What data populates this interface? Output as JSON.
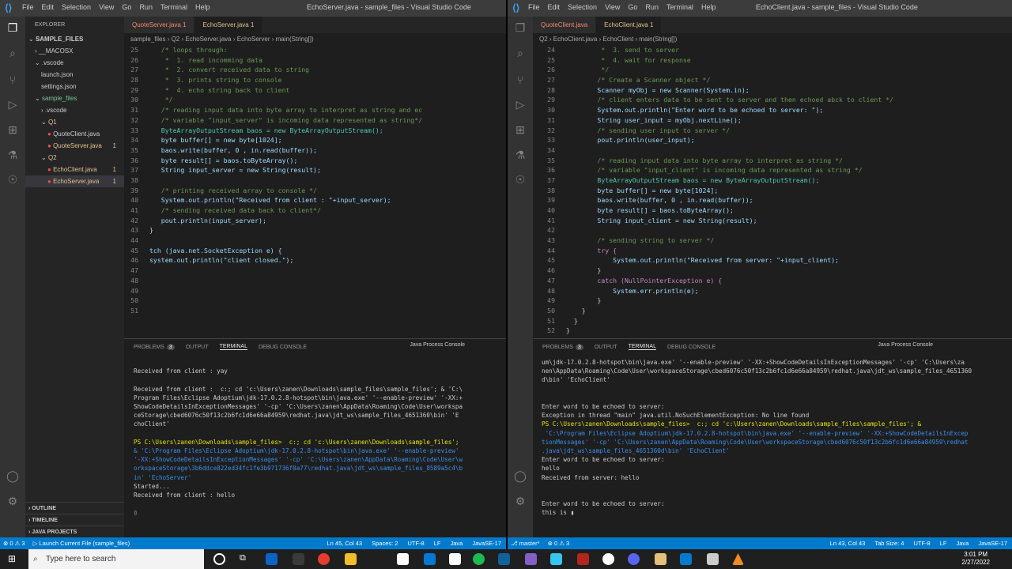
{
  "left": {
    "menu": [
      "File",
      "Edit",
      "Selection",
      "View",
      "Go",
      "Run",
      "Terminal",
      "Help"
    ],
    "title": "EchoServer.java - sample_files - Visual Studio Code",
    "explorer_label": "EXPLORER",
    "tree": [
      {
        "label": "SAMPLE_FILES",
        "indent": 0,
        "chev": "⌄",
        "bold": true
      },
      {
        "label": "__MACOSX",
        "indent": 1,
        "chev": "›"
      },
      {
        "label": ".vscode",
        "indent": 1,
        "chev": "⌄"
      },
      {
        "label": "launch.json",
        "indent": 2
      },
      {
        "label": "settings.json",
        "indent": 2
      },
      {
        "label": "sample_files",
        "indent": 1,
        "chev": "⌄",
        "color": "#73c991"
      },
      {
        "label": ".vscode",
        "indent": 2,
        "chev": "›"
      },
      {
        "label": "Q1",
        "indent": 2,
        "chev": "⌄",
        "color": "#e2c08d"
      },
      {
        "label": "QuoteClient.java",
        "indent": 3,
        "icon": true
      },
      {
        "label": "QuoteServer.java",
        "indent": 3,
        "icon": true,
        "color": "#e2c08d",
        "count": "1"
      },
      {
        "label": "Q2",
        "indent": 2,
        "chev": "⌄",
        "color": "#e2c08d"
      },
      {
        "label": "EchoClient.java",
        "indent": 3,
        "icon": true,
        "color": "#e2c08d",
        "count": "1"
      },
      {
        "label": "EchoServer.java",
        "indent": 3,
        "icon": true,
        "color": "#e2c08d",
        "count": "1",
        "selected": true
      }
    ],
    "bottom_sections": [
      "OUTLINE",
      "TIMELINE",
      "JAVA PROJECTS"
    ],
    "tabs": [
      {
        "label": "QuoteServer.java 1",
        "active": false
      },
      {
        "label": "EchoServer.java 1",
        "active": true
      }
    ],
    "breadcrumb": "sample_files  ›  Q2  ›  EchoServer.java  ›  EchoServer  ›  main(String[])",
    "code": [
      {
        "n": "25",
        "t": "   /* loops through:",
        "c": "cm"
      },
      {
        "n": "26",
        "t": "    *  1. read incomming data",
        "c": "cm"
      },
      {
        "n": "27",
        "t": "    *  2. convert received data to string",
        "c": "cm"
      },
      {
        "n": "28",
        "t": "    *  3. prints string to console",
        "c": "cm"
      },
      {
        "n": "29",
        "t": "    *  4. echo string back to client",
        "c": "cm"
      },
      {
        "n": "30",
        "t": "    */",
        "c": "cm"
      },
      {
        "n": "31",
        "t": "   /* reading input data into byte array to interpret as string and ec",
        "c": "cm"
      },
      {
        "n": "32",
        "t": "   /* variable \"input_server\" is incoming data represented as string*/",
        "c": "cm"
      },
      {
        "n": "33",
        "t": "   ByteArrayOutputStream baos = new ByteArrayOutputStream();",
        "c": "ty"
      },
      {
        "n": "34",
        "t": "   byte buffer[] = new byte[1024];",
        "c": "vr"
      },
      {
        "n": "35",
        "t": "   baos.write(buffer, 0 , in.read(buffer));",
        "c": "vr"
      },
      {
        "n": "36",
        "t": "   byte result[] = baos.toByteArray();",
        "c": "vr"
      },
      {
        "n": "37",
        "t": "   String input_server = new String(result);",
        "c": "vr"
      },
      {
        "n": "38",
        "t": "",
        "c": ""
      },
      {
        "n": "39",
        "t": "   /* printing received array to console */",
        "c": "cm"
      },
      {
        "n": "40",
        "t": "   System.out.println(\"Received from client : \"+input_server);",
        "c": "vr"
      },
      {
        "n": "41",
        "t": "   /* sending received data back to client*/",
        "c": "cm"
      },
      {
        "n": "42",
        "t": "   pout.println(input_server);",
        "c": "vr"
      },
      {
        "n": "43",
        "t": "}",
        "c": ""
      },
      {
        "n": "44",
        "t": "",
        "c": ""
      },
      {
        "n": "45",
        "t": "tch (java.net.SocketException e) {",
        "c": "vr"
      },
      {
        "n": "46",
        "t": "system.out.println(\"client closed.\");",
        "c": "vr"
      },
      {
        "n": "47",
        "t": "",
        "c": ""
      },
      {
        "n": "48",
        "t": "",
        "c": ""
      },
      {
        "n": "49",
        "t": "",
        "c": ""
      },
      {
        "n": "50",
        "t": "",
        "c": ""
      },
      {
        "n": "51",
        "t": "",
        "c": ""
      }
    ],
    "panel_tabs": [
      {
        "label": "PROBLEMS",
        "badge": "3"
      },
      {
        "label": "OUTPUT"
      },
      {
        "label": "TERMINAL",
        "active": true
      },
      {
        "label": "DEBUG CONSOLE"
      }
    ],
    "console_label": "Java Process Console",
    "terminal": [
      {
        "t": "",
        "c": ""
      },
      {
        "t": "Received from client : yay",
        "c": ""
      },
      {
        "t": "",
        "c": ""
      },
      {
        "t": "Received from client :  c:; cd 'c:\\Users\\zanen\\Downloads\\sample_files\\sample_files'; & 'C:\\",
        "c": ""
      },
      {
        "t": "Program Files\\Eclipse Adoptium\\jdk-17.0.2.8-hotspot\\bin\\java.exe' '--enable-preview' '-XX:+",
        "c": ""
      },
      {
        "t": "ShowCodeDetailsInExceptionMessages' '-cp' 'C:\\Users\\zanen\\AppData\\Roaming\\Code\\User\\workspa",
        "c": ""
      },
      {
        "t": "ceStorage\\cbed6076c50f13c2b6fc1d6e66a84959\\redhat.java\\jdt_ws\\sample_files_4651360\\bin' 'E",
        "c": ""
      },
      {
        "t": "choClient'",
        "c": ""
      },
      {
        "t": "",
        "c": ""
      },
      {
        "t": "PS C:\\Users\\zanen\\Downloads\\sample_files>  c:; cd 'c:\\Users\\zanen\\Downloads\\sample_files';",
        "c": "yl"
      },
      {
        "t": "& 'C:\\Program Files\\Eclipse Adoptium\\jdk-17.0.2.8-hotspot\\bin\\java.exe' '--enable-preview'",
        "c": "bl"
      },
      {
        "t": "'-XX:+ShowCodeDetailsInExceptionMessages' '-cp' 'C:\\Users\\zanen\\AppData\\Roaming\\Code\\User\\w",
        "c": "bl"
      },
      {
        "t": "orkspaceStorage\\3b6ddce822ed34fc1fe3b971736f0a77\\redhat.java\\jdt_ws\\sample_files_8589a5c4\\b",
        "c": "bl"
      },
      {
        "t": "in' 'EchoServer'",
        "c": "bl"
      },
      {
        "t": "Started...",
        "c": ""
      },
      {
        "t": "Received from client : hello",
        "c": ""
      },
      {
        "t": "",
        "c": ""
      },
      {
        "t": "▯",
        "c": ""
      }
    ],
    "status_left": [
      "⊗ 0  ⚠ 3",
      "▷ Launch Current File (sample_files)"
    ],
    "status_right": [
      "Ln 45, Col 43",
      "Spaces: 2",
      "UTF-8",
      "LF",
      "Java",
      "JavaSE-17"
    ]
  },
  "right": {
    "menu": [
      "File",
      "Edit",
      "Selection",
      "View",
      "Go",
      "Run",
      "Terminal",
      "Help"
    ],
    "title": "EchoClient.java - sample_files - Visual Studio Code",
    "tabs": [
      {
        "label": "QuoteClient.java",
        "active": false
      },
      {
        "label": "EchoClient.java 1",
        "active": true
      }
    ],
    "breadcrumb": "Q2  ›  EchoClient.java  ›  EchoClient  ›  main(String[])",
    "code": [
      {
        "n": "24",
        "t": "         *  3. send to server",
        "c": "cm"
      },
      {
        "n": "25",
        "t": "         *  4. wait for response",
        "c": "cm"
      },
      {
        "n": "26",
        "t": "         */",
        "c": "cm"
      },
      {
        "n": "27",
        "t": "        /* Create a Scanner object */",
        "c": "cm"
      },
      {
        "n": "28",
        "t": "        Scanner myObj = new Scanner(System.in);",
        "c": "vr"
      },
      {
        "n": "29",
        "t": "        /* client enters data to be sent to server and then echoed abck to client */",
        "c": "cm"
      },
      {
        "n": "30",
        "t": "        System.out.println(\"Enter word to be echoed to server: \");",
        "c": "vr"
      },
      {
        "n": "31",
        "t": "        String user_input = myObj.nextLine();",
        "c": "vr"
      },
      {
        "n": "32",
        "t": "        /* sending user input to server */",
        "c": "cm"
      },
      {
        "n": "33",
        "t": "        pout.println(user_input);",
        "c": "vr"
      },
      {
        "n": "34",
        "t": "",
        "c": ""
      },
      {
        "n": "35",
        "t": "        /* reading input data into byte array to interpret as string */",
        "c": "cm"
      },
      {
        "n": "36",
        "t": "        /* variable \"input_client\" is incoming data represented as string */",
        "c": "cm"
      },
      {
        "n": "37",
        "t": "        ByteArrayOutputStream baos = new ByteArrayOutputStream();",
        "c": "ty"
      },
      {
        "n": "38",
        "t": "        byte buffer[] = new byte[1024];",
        "c": "vr"
      },
      {
        "n": "39",
        "t": "        baos.write(buffer, 0 , in.read(buffer));",
        "c": "vr"
      },
      {
        "n": "40",
        "t": "        byte result[] = baos.toByteArray();",
        "c": "vr"
      },
      {
        "n": "41",
        "t": "        String input_client = new String(result);",
        "c": "vr"
      },
      {
        "n": "42",
        "t": "",
        "c": ""
      },
      {
        "n": "43",
        "t": "        /* sending string to server */",
        "c": "cm"
      },
      {
        "n": "44",
        "t": "        try {",
        "c": "kc"
      },
      {
        "n": "45",
        "t": "            System.out.println(\"Received from server: \"+input_client);",
        "c": "vr"
      },
      {
        "n": "46",
        "t": "        }",
        "c": ""
      },
      {
        "n": "47",
        "t": "        catch (NullPointerException e) {",
        "c": "kc"
      },
      {
        "n": "48",
        "t": "            System.err.println(e);",
        "c": "vr"
      },
      {
        "n": "49",
        "t": "        }",
        "c": ""
      },
      {
        "n": "50",
        "t": "    }",
        "c": ""
      },
      {
        "n": "51",
        "t": "  }",
        "c": ""
      },
      {
        "n": "52",
        "t": "}",
        "c": ""
      },
      {
        "n": "53",
        "t": "",
        "c": ""
      }
    ],
    "panel_tabs": [
      {
        "label": "PROBLEMS",
        "badge": "3"
      },
      {
        "label": "OUTPUT"
      },
      {
        "label": "TERMINAL",
        "active": true
      },
      {
        "label": "DEBUG CONSOLE"
      }
    ],
    "console_label": "Java Process Console",
    "terminal": [
      {
        "t": "um\\jdk-17.0.2.8-hotspot\\bin\\java.exe' '--enable-preview' '-XX:+ShowCodeDetailsInExceptionMessages' '-cp' 'C:\\Users\\za",
        "c": ""
      },
      {
        "t": "nen\\AppData\\Roaming\\Code\\User\\workspaceStorage\\cbed6076c50f13c2b6fc1d6e66a84959\\redhat.java\\jdt_ws\\sample_files_4651360",
        "c": ""
      },
      {
        "t": "d\\bin' 'EchoClient'",
        "c": ""
      },
      {
        "t": "",
        "c": ""
      },
      {
        "t": "",
        "c": ""
      },
      {
        "t": "Enter word to be echoed to server:",
        "c": ""
      },
      {
        "t": "Exception in thread \"main\" java.util.NoSuchElementException: No line found",
        "c": ""
      },
      {
        "t": "PS C:\\Users\\zanen\\Downloads\\sample_files>  c:; cd 'c:\\Users\\zanen\\Downloads\\sample_files\\sample_files'; &",
        "c": "yl"
      },
      {
        "t": " 'C:\\Program Files\\Eclipse Adoptium\\jdk-17.0.2.8-hotspot\\bin\\java.exe' '--enable-preview' '-XX:+ShowCodeDetailsInExcep",
        "c": "bl"
      },
      {
        "t": "tionMessages' '-cp' 'C:\\Users\\zanen\\AppData\\Roaming\\Code\\User\\workspaceStorage\\cbed6076c50f13c2b6fc1d6e66a84959\\redhat",
        "c": "bl"
      },
      {
        "t": ".java\\jdt_ws\\sample_files_4651360d\\bin' 'EchoClient'",
        "c": "bl"
      },
      {
        "t": "Enter word to be echoed to server:",
        "c": ""
      },
      {
        "t": "hello",
        "c": ""
      },
      {
        "t": "Received from server: hello",
        "c": ""
      },
      {
        "t": "",
        "c": ""
      },
      {
        "t": "",
        "c": ""
      },
      {
        "t": "Enter word to be echoed to server:",
        "c": ""
      },
      {
        "t": "this is ▮",
        "c": ""
      }
    ],
    "status_left": [
      "⎇ master*",
      "⊗ 0  ⚠ 3"
    ],
    "status_right": [
      "Ln 43, Col 43",
      "Tab Size: 4",
      "UTF-8",
      "LF",
      "Java",
      "JavaSE-17"
    ]
  },
  "taskbar": {
    "search_placeholder": "Type here to search",
    "time": "3:01 PM",
    "date": "2/27/2022"
  }
}
